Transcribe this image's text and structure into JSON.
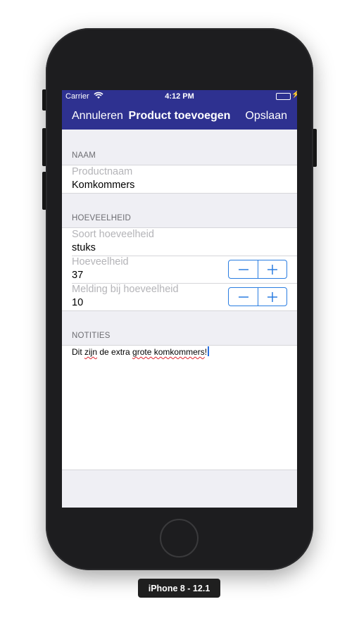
{
  "status_bar": {
    "carrier": "Carrier",
    "time": "4:12 PM",
    "icons": [
      "wifi-icon",
      "battery-icon"
    ],
    "battery_color": "#4cd964"
  },
  "nav_bar": {
    "background": "#2e3190",
    "cancel_label": "Annuleren",
    "title": "Product toevoegen",
    "save_label": "Opslaan"
  },
  "form": {
    "naam": {
      "header": "NAAM",
      "field": {
        "label": "Productnaam",
        "value": "Komkommers"
      }
    },
    "hoeveelheid": {
      "header": "HOEVEELHEID",
      "soort": {
        "label": "Soort hoeveelheid",
        "value": "stuks"
      },
      "hoeveelheid": {
        "label": "Hoeveelheid",
        "value": "37"
      },
      "melding": {
        "label": "Melding bij hoeveelheid",
        "value": "10"
      }
    },
    "notities": {
      "header": "NOTITIES",
      "parts": [
        {
          "text": "Dit ",
          "misspelled": false
        },
        {
          "text": "zijn",
          "misspelled": true
        },
        {
          "text": " de extra ",
          "misspelled": false
        },
        {
          "text": "grote komkommers",
          "misspelled": true
        },
        {
          "text": "!",
          "misspelled": false
        }
      ]
    }
  },
  "stepper": {
    "accent": "#2a7de1",
    "icons": [
      "minus-icon",
      "plus-icon"
    ]
  },
  "device": {
    "label": "iPhone 8 - 12.1"
  }
}
